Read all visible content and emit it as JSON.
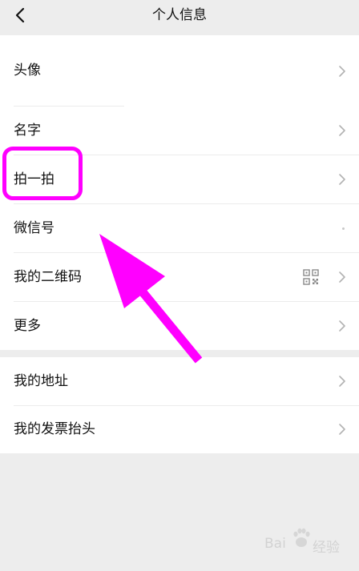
{
  "header": {
    "title": "个人信息",
    "back_icon": "chevron-left-icon"
  },
  "section1": {
    "items": [
      {
        "label": "头像"
      },
      {
        "label": "名字"
      },
      {
        "label": "拍一拍"
      },
      {
        "label": "微信号"
      },
      {
        "label": "我的二维码",
        "icon": "qr-code-icon"
      },
      {
        "label": "更多"
      }
    ]
  },
  "section2": {
    "items": [
      {
        "label": "我的地址"
      },
      {
        "label": "我的发票抬头"
      }
    ]
  },
  "annotation": {
    "color": "#ff00ff"
  },
  "watermark": {
    "brand_left": "Bai",
    "brand_right": "经验"
  }
}
